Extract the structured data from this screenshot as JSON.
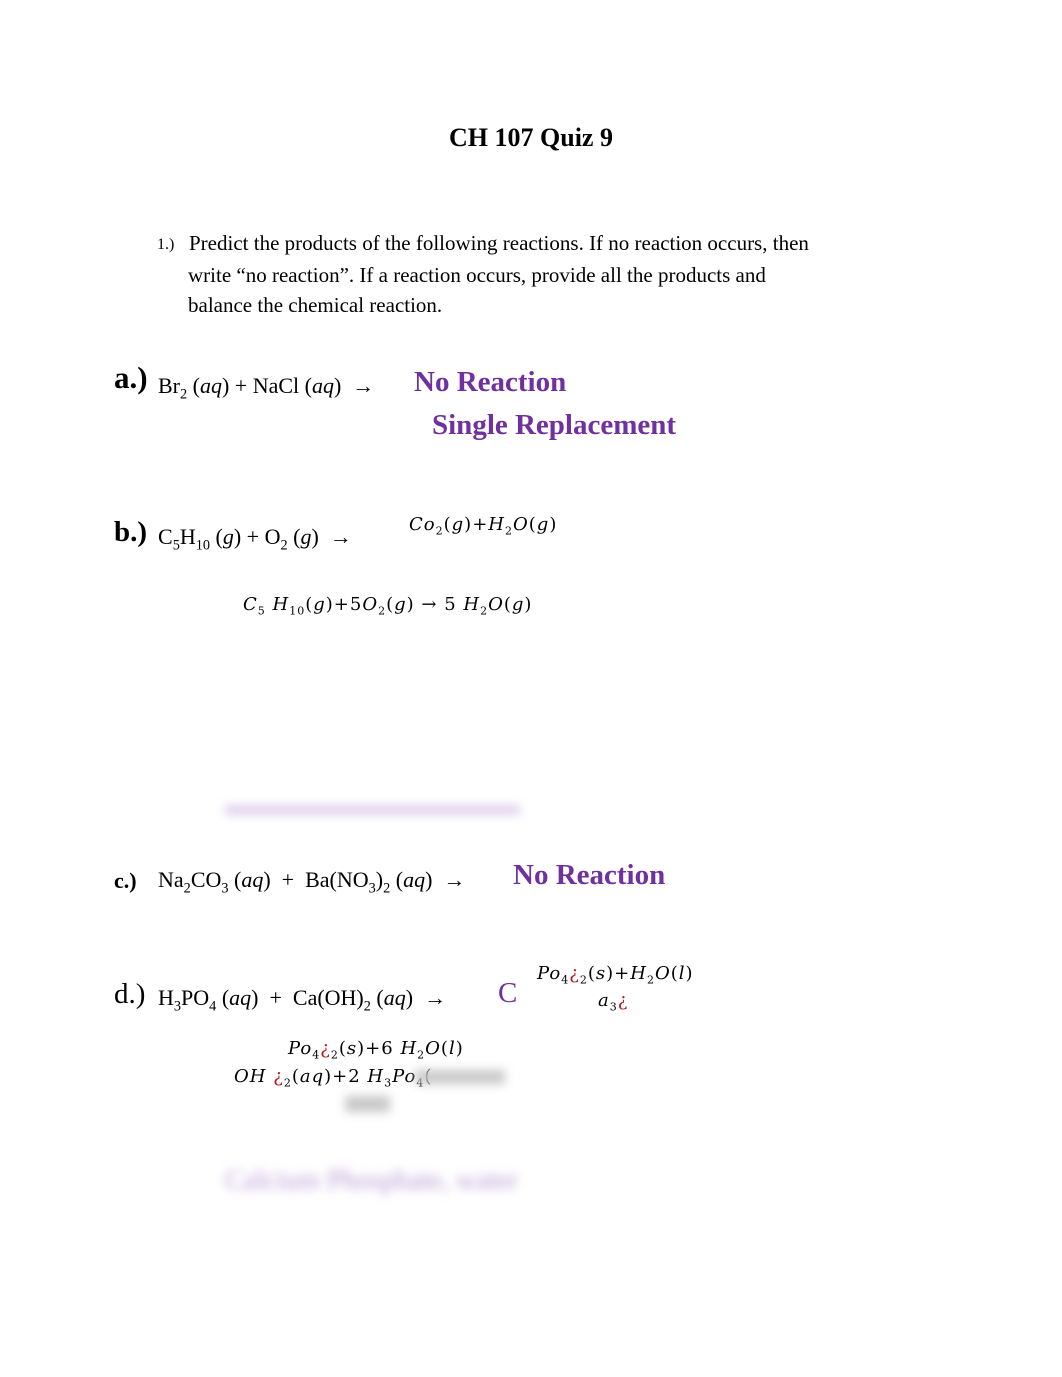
{
  "title": "CH 107 Quiz 9",
  "question": {
    "number": "1.)",
    "line1": "Predict the products of the following reactions.  If no reaction occurs, then",
    "line2": "write “no reaction”.  If a reaction occurs, provide all the products and",
    "line3": "balance the chemical reaction."
  },
  "parts": {
    "a": {
      "label": "a.)",
      "answer": "No Reaction",
      "type": "Single Replacement"
    },
    "b": {
      "label": "b.)"
    },
    "c": {
      "label": "c.)",
      "answer": "No Reaction"
    },
    "d": {
      "label": "d.)",
      "answer_prefix": "C",
      "blurred_answer": "Calcium Phosphate, water"
    }
  },
  "colors": {
    "accent_purple": "#7030a0",
    "glyph_red": "#b31b1b"
  }
}
